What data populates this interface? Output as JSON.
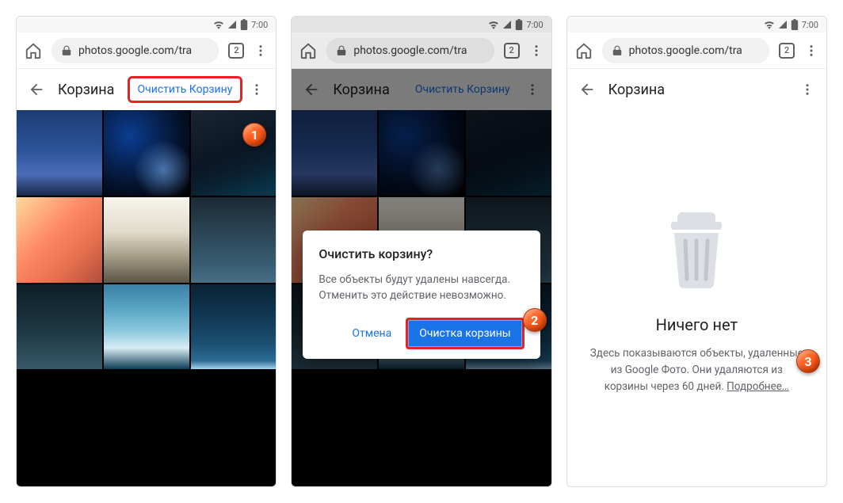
{
  "status": {
    "time": "7:00"
  },
  "urlbar": {
    "url": "photos.google.com/tra",
    "tab_count": "2"
  },
  "screen1": {
    "appbar": {
      "title": "Корзина",
      "action": "Очистить Корзину"
    }
  },
  "screen2": {
    "appbar": {
      "title": "Корзина",
      "action": "Очистить Корзину"
    },
    "modal": {
      "title": "Очистить корзину?",
      "body": "Все объекты будут удалены навсегда. Отменить это действие невозможно.",
      "cancel": "Отмена",
      "confirm": "Очистка корзины"
    }
  },
  "screen3": {
    "appbar": {
      "title": "Корзина"
    },
    "empty": {
      "heading": "Ничего нет",
      "body": "Здесь показываются объекты, удаленные из Google Фото. Они удаляются из корзины через 60 дней. ",
      "more": "Подробнее…"
    }
  },
  "badges": {
    "one": "1",
    "two": "2",
    "three": "3"
  }
}
